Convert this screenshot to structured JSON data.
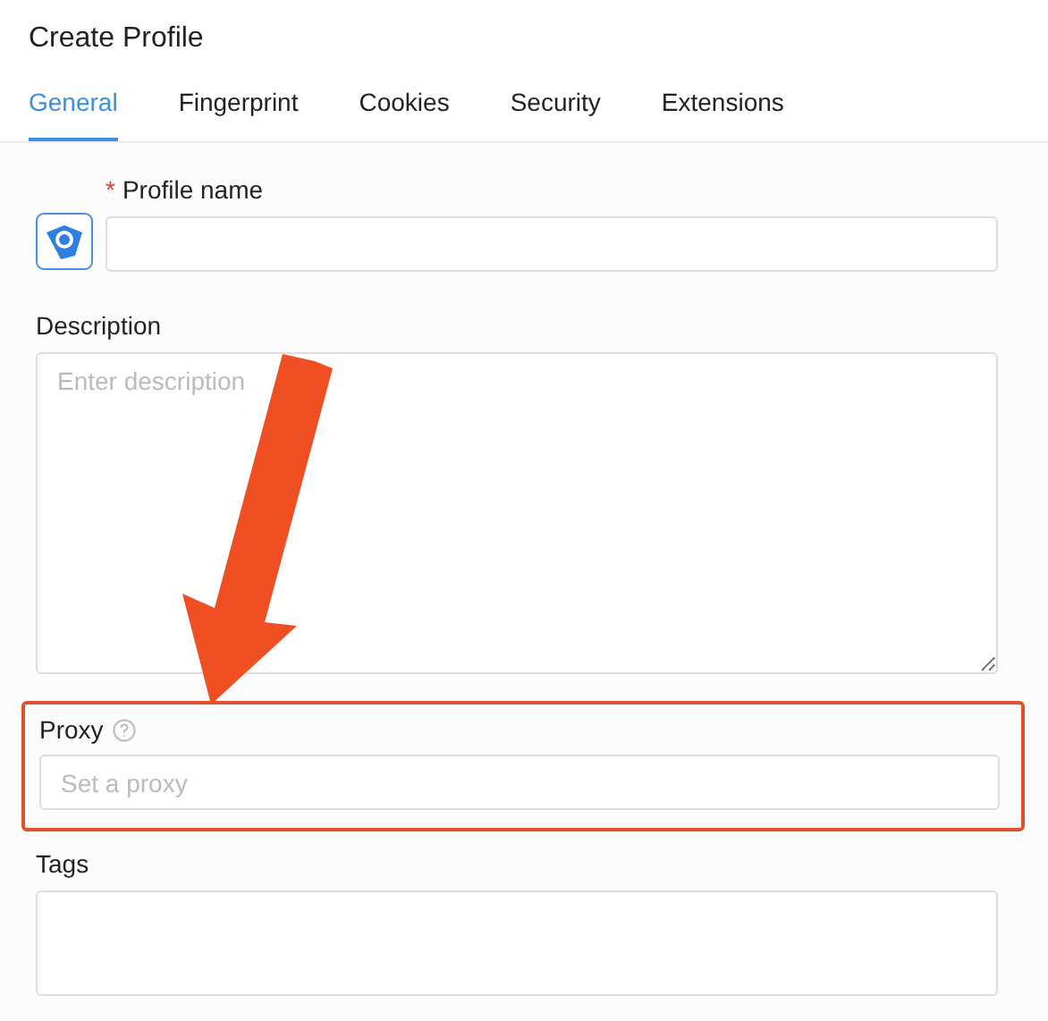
{
  "title": "Create Profile",
  "tabs": [
    {
      "label": "General",
      "selected": true
    },
    {
      "label": "Fingerprint",
      "selected": false
    },
    {
      "label": "Cookies",
      "selected": false
    },
    {
      "label": "Security",
      "selected": false
    },
    {
      "label": "Extensions",
      "selected": false
    }
  ],
  "profile_name": {
    "label": "Profile name",
    "required": true,
    "required_mark": "*"
  },
  "description": {
    "label": "Description",
    "placeholder": "Enter description"
  },
  "proxy": {
    "label": "Proxy",
    "placeholder": "Set a proxy",
    "highlighted": true
  },
  "tags": {
    "label": "Tags"
  }
}
